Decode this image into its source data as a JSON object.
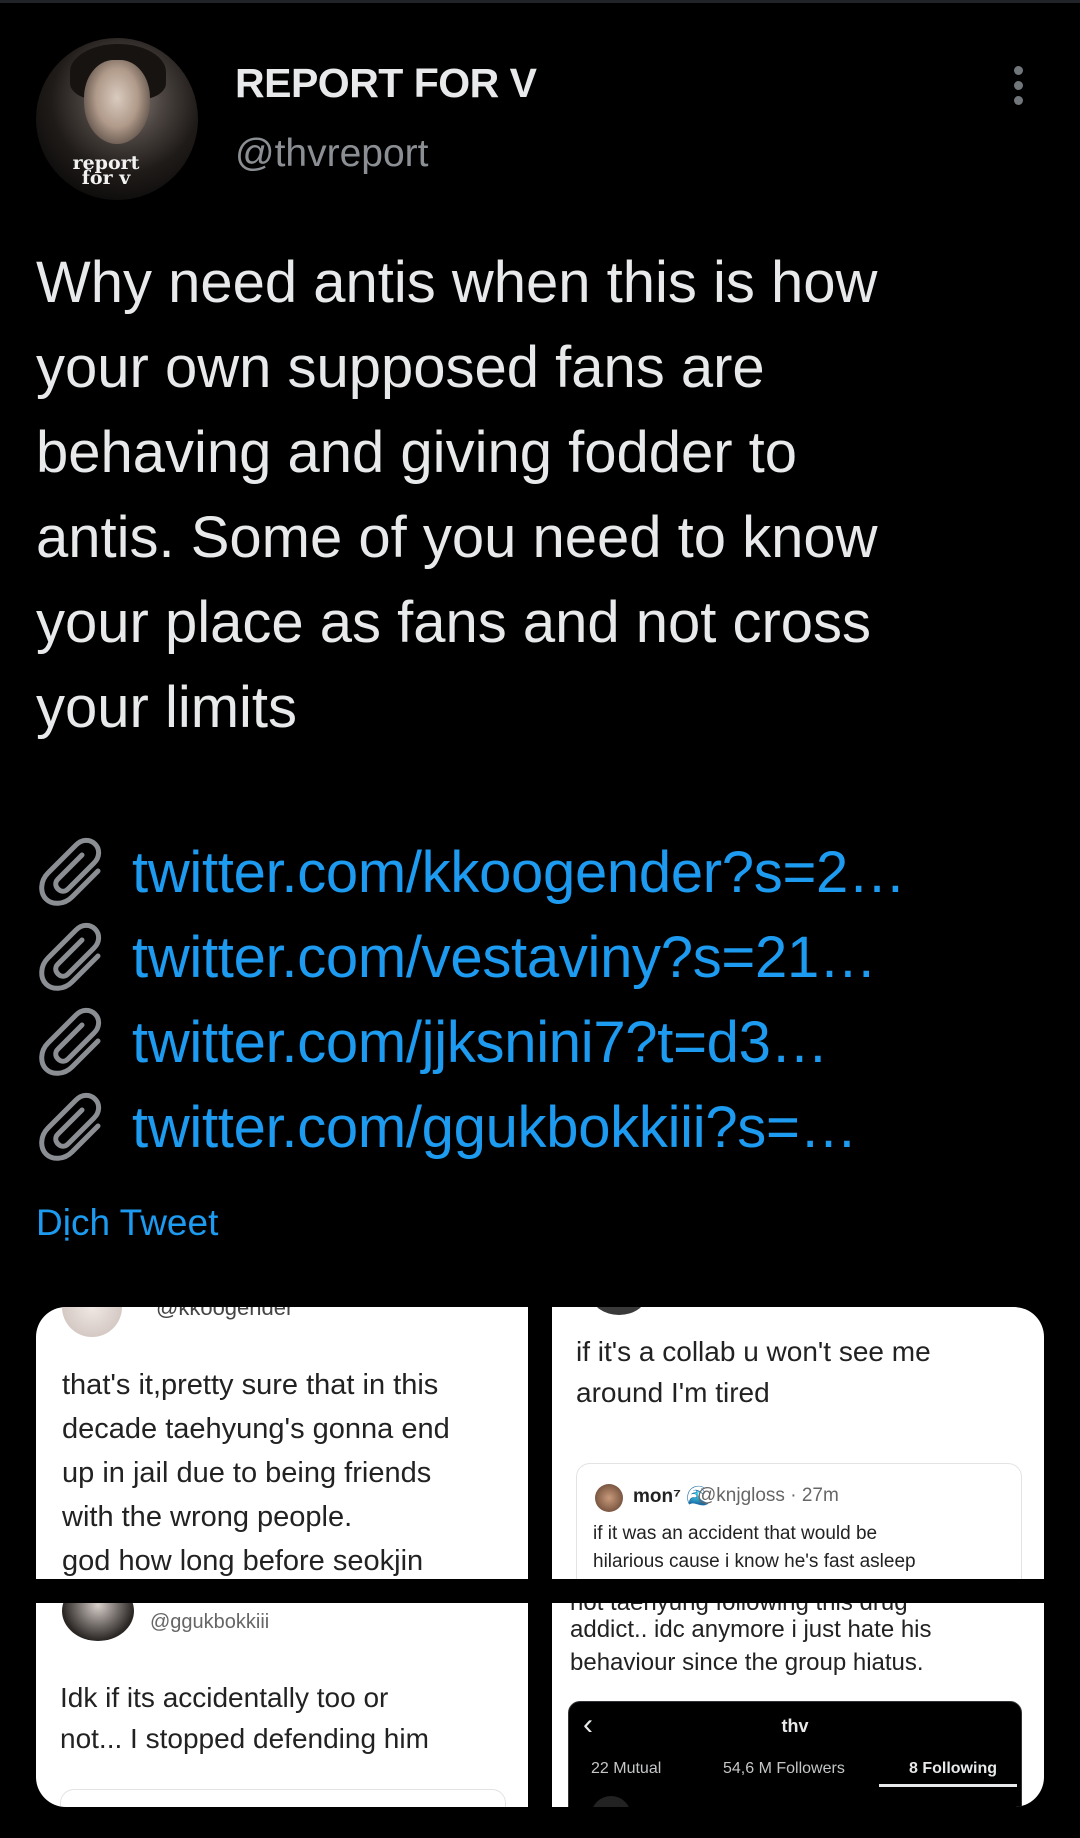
{
  "author": {
    "display_name": "REPORT FOR V",
    "handle": "@thvreport",
    "avatar_logo_text": "report\nfor v"
  },
  "tweet": {
    "text": "Why need antis when this is how\nyour own supposed fans are\nbehaving and giving fodder to\nantis. Some of you need to know\nyour place as fans and not cross\nyour limits",
    "links": [
      {
        "icon": "paperclip-icon",
        "text": "twitter.com/kkoogender?s=2…"
      },
      {
        "icon": "paperclip-icon",
        "text": "twitter.com/vestaviny?s=21…"
      },
      {
        "icon": "paperclip-icon",
        "text": "twitter.com/jjksnini7?t=d3…"
      },
      {
        "icon": "paperclip-icon",
        "text": "twitter.com/ggukbokkiii?s=…"
      }
    ],
    "translate_label": "Dịch Tweet"
  },
  "media": {
    "tile1": {
      "cut_handle": "@kkoogender",
      "text": "that's it,pretty sure that in this\ndecade taehyung's gonna end\nup in jail due to being friends\nwith the wrong people.\ngod how long before seokjin"
    },
    "tile2": {
      "text": "if it's a collab u won't see me\naround I'm tired",
      "quote": {
        "name": "mon⁷ 🌊",
        "meta": "@knjgloss · 27m",
        "text": "if it was an accident that would be\nhilarious cause i know he's fast asleep"
      }
    },
    "tile3": {
      "handle": "@ggukbokkiii",
      "text": "Idk if its accidentally too or\nnot... I stopped defending him"
    },
    "tile4": {
      "cut_text": "not taehyung following this drug",
      "text": "addict.. idc anymore i just hate his\nbehaviour since the group hiatus.",
      "profile": {
        "title": "thv",
        "mutual": "22 Mutual",
        "followers": "54,6 M Followers",
        "following": "8 Following"
      }
    }
  },
  "colors": {
    "background": "#000000",
    "text": "#e7e9ea",
    "secondary": "#8b8f94",
    "link": "#1d9bf0"
  }
}
